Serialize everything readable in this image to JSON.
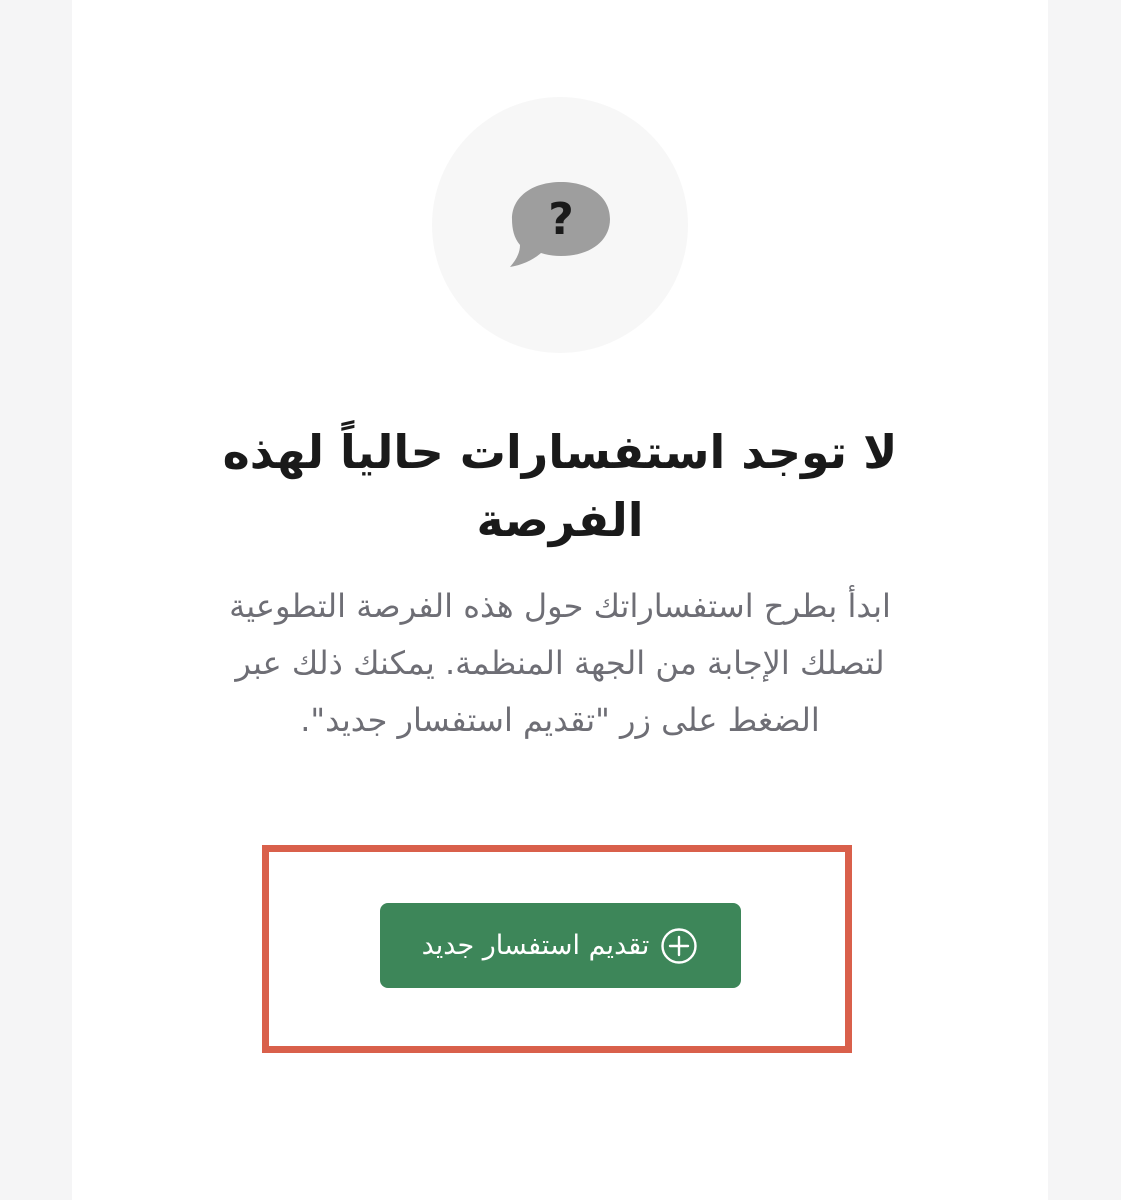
{
  "empty_state": {
    "icon": "question-chat-bubble-icon",
    "title": "لا توجد استفسارات حالياً لهذه الفرصة",
    "description": "ابدأ بطرح استفساراتك حول هذه الفرصة التطوعية لتصلك الإجابة من الجهة المنظمة. يمكنك ذلك عبر الضغط على زر \"تقديم استفسار جديد\".",
    "button_label": "تقديم استفسار جديد",
    "button_icon": "plus-circle-icon"
  },
  "colors": {
    "page_background": "#f5f5f6",
    "card_background": "#ffffff",
    "icon_circle": "#f7f7f7",
    "icon_bubble": "#9e9e9e",
    "title_text": "#1a1a1a",
    "description_text": "#6e6e75",
    "button_background": "#3d8659",
    "button_text": "#ffffff",
    "highlight_border": "#d9604b"
  }
}
